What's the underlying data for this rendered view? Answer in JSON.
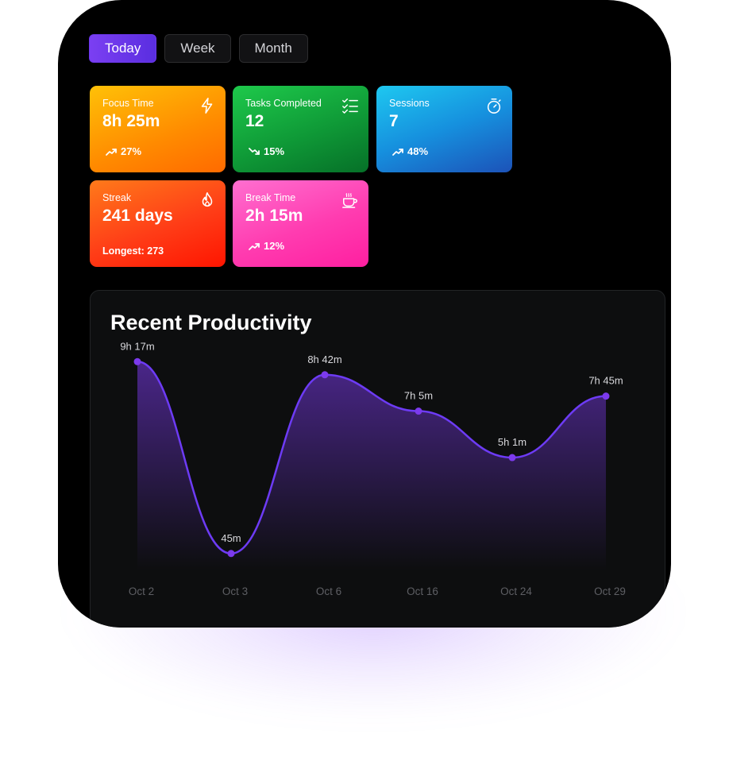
{
  "tabs": [
    {
      "label": "Today",
      "active": true
    },
    {
      "label": "Week",
      "active": false
    },
    {
      "label": "Month",
      "active": false
    }
  ],
  "cards": {
    "focus": {
      "label": "Focus Time",
      "value": "8h 25m",
      "delta": "27%",
      "trend": "up",
      "icon": "lightning-icon"
    },
    "tasks": {
      "label": "Tasks Completed",
      "value": "12",
      "delta": "15%",
      "trend": "down",
      "icon": "checklist-icon"
    },
    "sessions": {
      "label": "Sessions",
      "value": "7",
      "delta": "48%",
      "trend": "up",
      "icon": "stopwatch-icon"
    },
    "streak": {
      "label": "Streak",
      "value": "241 days",
      "sub": "Longest: 273",
      "icon": "flame-icon"
    },
    "break": {
      "label": "Break Time",
      "value": "2h 15m",
      "delta": "12%",
      "trend": "up",
      "icon": "coffee-icon"
    }
  },
  "panel": {
    "title": "Recent Productivity"
  },
  "colors": {
    "accent": "#7c3aed",
    "line": "#6d3bf5",
    "panel": "#0d0e0f"
  },
  "chart_data": {
    "type": "area",
    "categories": [
      "Oct 2",
      "Oct 3",
      "Oct 6",
      "Oct 16",
      "Oct 24",
      "Oct 29"
    ],
    "values": [
      557,
      45,
      522,
      425,
      301,
      465
    ],
    "labels": [
      "9h 17m",
      "45m",
      "8h 42m",
      "7h 5m",
      "5h 1m",
      "7h 45m"
    ],
    "ylim": [
      0,
      600
    ],
    "grid": false
  }
}
